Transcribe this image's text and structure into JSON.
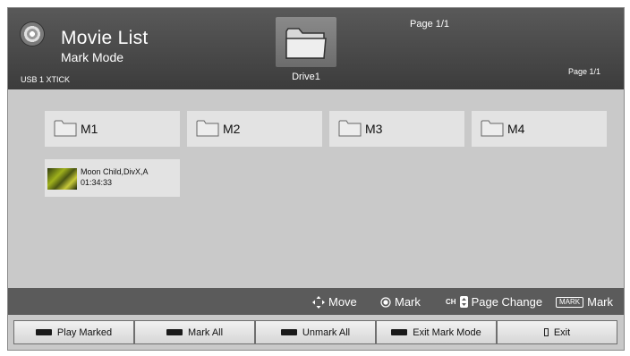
{
  "header": {
    "title": "Movie List",
    "mode": "Mark Mode",
    "device": "USB 1 XTICK",
    "drive_label": "Drive1",
    "page_top": "Page 1/1",
    "page_right": "Page 1/1",
    "app_icon": "film-reel-icon",
    "drive_icon": "folder-icon"
  },
  "folders": [
    {
      "label": "M1"
    },
    {
      "label": "M2"
    },
    {
      "label": "M3"
    },
    {
      "label": "M4"
    }
  ],
  "file": {
    "name": "Moon Child,DivX,A",
    "duration": "01:34:33"
  },
  "hints": {
    "move": "Move",
    "mark": "Mark",
    "ch_tag": "CH",
    "page_change": "Page Change",
    "mark_tag": "MARK",
    "mark_key": "Mark"
  },
  "buttons": {
    "play_marked": "Play Marked",
    "mark_all": "Mark All",
    "unmark_all": "Unmark All",
    "exit_mark_mode": "Exit Mark Mode",
    "exit": "Exit"
  },
  "colors": {
    "header": "#4a4a4a",
    "content_bg": "#c9c9c9",
    "tile_bg": "#e3e3e3",
    "hint_bar": "#5b5b5b"
  }
}
